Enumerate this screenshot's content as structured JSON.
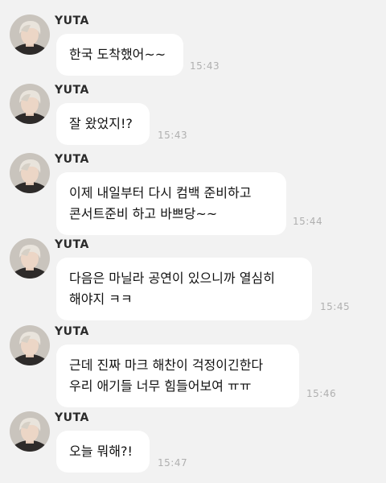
{
  "colors": {
    "background": "#f2f2f2",
    "bubble": "#ffffff",
    "text": "#111111",
    "timestamp": "#b0b0b0"
  },
  "messages": [
    {
      "sender": "YUTA",
      "text": "한국 도착했어~~",
      "time": "15:43",
      "avatar_icon": "profile-avatar"
    },
    {
      "sender": "YUTA",
      "text": "잘 왔었지!?",
      "time": "15:43",
      "avatar_icon": "profile-avatar"
    },
    {
      "sender": "YUTA",
      "text": "이제 내일부터 다시 컴백 준비하고\n콘서트준비 하고 바쁘당~~",
      "time": "15:44",
      "avatar_icon": "profile-avatar"
    },
    {
      "sender": "YUTA",
      "text": "다음은 마닐라 공연이 있으니까 열심히\n해야지 ㅋㅋ",
      "time": "15:45",
      "avatar_icon": "profile-avatar"
    },
    {
      "sender": "YUTA",
      "text": "근데 진짜 마크 해찬이 걱정이긴한다\n우리 애기들 너무 힘들어보여 ㅠㅠ",
      "time": "15:46",
      "avatar_icon": "profile-avatar"
    },
    {
      "sender": "YUTA",
      "text": "오늘 뭐해?!",
      "time": "15:47",
      "avatar_icon": "profile-avatar"
    }
  ]
}
